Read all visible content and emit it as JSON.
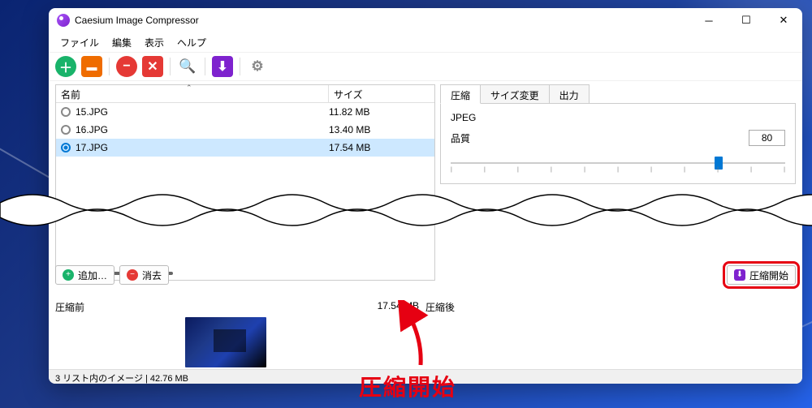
{
  "app": {
    "title": "Caesium Image Compressor"
  },
  "menu": {
    "file": "ファイル",
    "edit": "編集",
    "view": "表示",
    "help": "ヘルプ"
  },
  "toolbar": {
    "add": {
      "color": "#19b36a",
      "glyph": "＋"
    },
    "open": {
      "color": "#ef6c00",
      "glyph": "📂"
    },
    "remove": {
      "color": "#e53935",
      "glyph": "−"
    },
    "removex": {
      "color": "#e53935",
      "glyph": "✕"
    },
    "search": {
      "color": "#00bcd4",
      "glyph": "🔍"
    },
    "compress": {
      "color": "#7e22ce",
      "glyph": "⬇"
    },
    "settings": {
      "color": "#9e9e9e",
      "glyph": "⚙"
    }
  },
  "list": {
    "header_name": "名前",
    "header_size": "サイズ",
    "rows": [
      {
        "name": "15.JPG",
        "size": "11.82 MB",
        "selected": false
      },
      {
        "name": "16.JPG",
        "size": "13.40 MB",
        "selected": false
      },
      {
        "name": "17.JPG",
        "size": "17.54 MB",
        "selected": true
      }
    ]
  },
  "tabs": {
    "compress": "圧縮",
    "resize": "サイズ変更",
    "output": "出力"
  },
  "compression": {
    "section": "JPEG",
    "quality_label": "品質",
    "quality_value": "80",
    "slider_percent": 80
  },
  "actions": {
    "add": "追加…",
    "clear": "消去",
    "start": "圧縮開始"
  },
  "preview": {
    "before_label": "圧縮前",
    "after_label": "圧縮後",
    "before_size": "17.54 MB"
  },
  "status": {
    "text": "3 リスト内のイメージ | 42.76 MB"
  },
  "annotation": {
    "text": "圧縮開始"
  }
}
